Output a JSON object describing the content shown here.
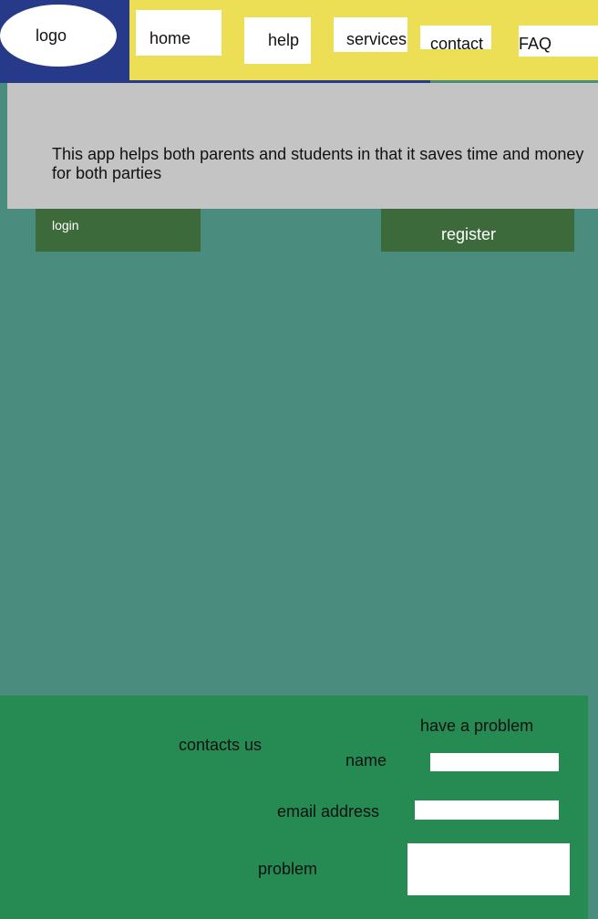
{
  "header": {
    "logo_label": "logo",
    "nav": {
      "home": "home",
      "help": "help",
      "services": "services",
      "contact": "contact",
      "faq": "FAQ"
    }
  },
  "hero": {
    "text": "This app  helps both parents and students in that it saves time and money for both parties"
  },
  "actions": {
    "login_label": "login",
    "register_label": "register"
  },
  "footer": {
    "contacts_label": "contacts us",
    "problem_heading": "have  a  problem",
    "name_label": "name",
    "email_label": "email address",
    "problem_label": "problem",
    "name_value": "",
    "email_value": "",
    "problem_value": ""
  },
  "colors": {
    "header_left": "#273a8a",
    "header_right": "#ecdf55",
    "hero_bg": "#c4c4c4",
    "page_bg": "#4a8c7e",
    "button_bg": "#3d6a3a",
    "footer_bg": "#268a53"
  }
}
